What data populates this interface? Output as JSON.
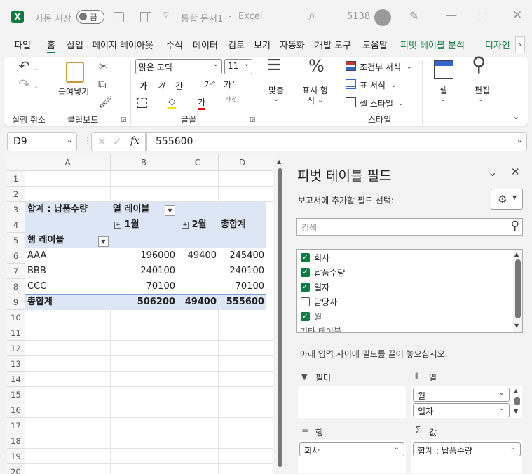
{
  "titlebar": {
    "autosave_label": "자동 저장",
    "autosave_state": "끔",
    "doc_title": "통합 문서1",
    "dash": "-",
    "app": "Excel",
    "user_number": "5138"
  },
  "tabs": [
    "파일",
    "홈",
    "삽입",
    "페이지 레이아웃",
    "수식",
    "데이터",
    "검토",
    "보기",
    "자동화",
    "개발 도구",
    "도움말",
    "피벗 테이블 분석",
    "디자인"
  ],
  "ribbon": {
    "undo_group": "실행 취소",
    "paste": "붙여넣기",
    "clipboard_group": "클립보드",
    "font_name": "맑은 고딕",
    "font_size": "11",
    "bold_glyph": "가",
    "italic_glyph": "가",
    "underline_glyph": "간",
    "grow_glyph": "가˄",
    "shrink_glyph": "가˅",
    "font_color_glyph": "가",
    "phonetic_glyph": "내천",
    "font_group": "글꼴",
    "align": "맞춤",
    "number_line1": "표시 형",
    "number_line2": "식",
    "cond_format": "조건부 서식",
    "table_format": "표 서식",
    "cell_style": "셀 스타일",
    "style_group": "스타일",
    "cells": "셀",
    "editing": "편집"
  },
  "formula": {
    "name_box": "D9",
    "fx": "fx",
    "value": "555600"
  },
  "grid": {
    "columns": [
      "A",
      "B",
      "C",
      "D"
    ],
    "rows": [
      "1",
      "2",
      "3",
      "4",
      "5",
      "6",
      "7",
      "8",
      "9",
      "10",
      "11",
      "12",
      "13",
      "14",
      "15",
      "16",
      "17",
      "18",
      "19",
      "20"
    ],
    "r3_a": "합계 : 납품수량",
    "r3_b": "열 레이블",
    "r4_b": "1월",
    "r4_c": "2월",
    "r4_d": "총합계",
    "r5_a": "행 레이블",
    "r6": [
      "AAA",
      "196000",
      "49400",
      "245400"
    ],
    "r7": [
      "BBB",
      "240100",
      "",
      "240100"
    ],
    "r8": [
      "CCC",
      "70100",
      "",
      "70100"
    ],
    "r9": [
      "총합계",
      "506200",
      "49400",
      "555600"
    ]
  },
  "pane": {
    "title": "피벗 테이블 필드",
    "subtitle": "보고서에 추가할 필드 선택:",
    "search_placeholder": "검색",
    "fields": [
      {
        "label": "회사",
        "checked": true
      },
      {
        "label": "납품수량",
        "checked": true
      },
      {
        "label": "일자",
        "checked": true
      },
      {
        "label": "담당자",
        "checked": false
      },
      {
        "label": "월",
        "checked": true
      }
    ],
    "more_tables": "기타 테이블",
    "drag_hint": "아래 영역 사이에 필드를 끌어 놓으십시오.",
    "filters_label": "필터",
    "columns_label": "열",
    "rows_label": "행",
    "values_label": "값",
    "columns_items": [
      "월",
      "일자"
    ],
    "rows_items": [
      "회사"
    ],
    "values_items": [
      "합계 : 납품수량"
    ]
  }
}
